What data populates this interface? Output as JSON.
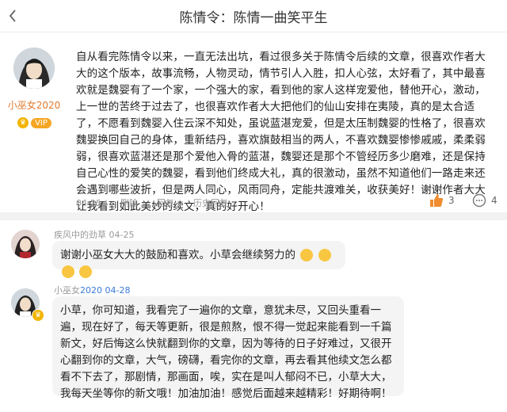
{
  "header": {
    "title": "陈情令：陈情一曲笑平生"
  },
  "post": {
    "author_name": "小巫女2020",
    "vip_label": "VIP",
    "body": "自从看完陈情令以来，一直无法出坑，看过很多关于陈情令后续的文章，很喜欢作者大大的这个版本，故事流畅，人物灵动，情节引人入胜，扣人心弦，太好看了，其中最喜欢就是魏婴有了一个家，一个强大的家，看到他的家人这样宠爱他，替他开心，激动，上一世的苦终于过去了，也很喜欢作者大大把他们的仙山安排在夷陵，真的是太合适了，不愿看到魏婴入住云深不知处，虽说蓝湛宠爱，但是太压制魏婴的性格了，很喜欢魏婴换回自己的身体，重新结丹，喜欢旗鼓相当的两人，不喜欢魏婴惨惨戚戚，柔柔弱弱，很喜欢蓝湛还是那个爱他入骨的蓝湛，魏婴还是那个不管经历多少磨难，还是保持自己心性的爱笑的魏婴，看到他们终成大礼，真的很激动，虽然不知道他们一路走来还会遇到哪些波折，但是两人同心，风雨同舟，定能共渡难关，收获美好！谢谢作者大大让我看到如此美妙的续文，真的好开心！",
    "date": "04-25",
    "delete_label": "删除",
    "reply_label": "回复",
    "history_label": "历史回复",
    "likes": "3",
    "comments": "4"
  },
  "replies": [
    {
      "name": "疾风中的劲草",
      "date": "04-25",
      "text": "谢谢小巫女大大的鼓励和喜欢。小草会继续努力的"
    },
    {
      "name_prefix": "小巫女",
      "name_highlight": "2020 04-28",
      "text": "小草，你可知道，我看完了一遍你的文章，意犹未尽，又回头重看一遍，现在好了，每天等更新，很是煎熬，恨不得一觉起来能看到一千篇新文，好后悔这么快就翻到你的文章，因为等待的日子好难过，又很开心翻到你的文章，大气，磅礴，看完你的文章，再去看其他续文怎么都看不下去了，那剧情，那画面，唉，实在是叫人郁闷不已，小草大大，我每天坐等你的新文哦！加油加油！感觉后面越来越精彩！好期待啊！"
    }
  ],
  "colors": {
    "author_orange": "#e07a2e",
    "vip_gold": "#f5a623",
    "link_blue": "#3a7bd5",
    "like_orange": "#f08c2e"
  }
}
